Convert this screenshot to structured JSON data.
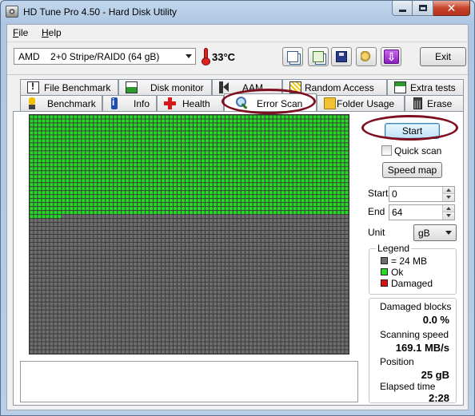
{
  "window": {
    "title": "HD Tune Pro 4.50 - Hard Disk Utility",
    "close_glyph": "✕"
  },
  "menu": [
    {
      "label": "File",
      "mnemonic": "F",
      "rest": "ile"
    },
    {
      "label": "Help",
      "mnemonic": "H",
      "rest": "elp"
    }
  ],
  "toolbar": {
    "drive_vendor": "AMD",
    "drive_name": "2+0 Stripe/RAID0 (64 gB)",
    "temperature": "33",
    "temperature_unit": "°C",
    "icons": [
      "copy-info-icon",
      "copy-screenshot-icon",
      "save-icon",
      "options-icon",
      "download-icon"
    ],
    "exit_label": "Exit"
  },
  "tabs_row1": [
    {
      "label": "File Benchmark",
      "icon": "file-benchmark-icon"
    },
    {
      "label": "Disk monitor",
      "icon": "disk-monitor-icon"
    },
    {
      "label": "AAM",
      "icon": "speaker-icon"
    },
    {
      "label": "Random Access",
      "icon": "random-access-icon"
    },
    {
      "label": "Extra tests",
      "icon": "extra-tests-icon"
    }
  ],
  "tabs_row2": [
    {
      "label": "Benchmark",
      "icon": "benchmark-icon"
    },
    {
      "label": "Info",
      "icon": "info-icon"
    },
    {
      "label": "Health",
      "icon": "health-cross-icon"
    },
    {
      "label": "Error Scan",
      "icon": "magnifier-icon",
      "active": true
    },
    {
      "label": "Folder Usage",
      "icon": "folder-icon"
    },
    {
      "label": "Erase",
      "icon": "trash-icon"
    }
  ],
  "scan_grid": {
    "columns": 80,
    "rows": 60,
    "scanned_blocks": 2008,
    "colors": {
      "ok": "#22dd22",
      "unscanned": "#6e6e6e",
      "damaged": "#dd1111",
      "gridline": "#3b3b3b"
    }
  },
  "controls": {
    "start_label": "Start",
    "quick_scan_label": "Quick scan",
    "quick_scan_checked": false,
    "speed_map_label": "Speed map",
    "start_field_label": "Start",
    "start_value": "0",
    "end_field_label": "End",
    "end_value": "64",
    "unit_label": "Unit",
    "unit_value": "gB"
  },
  "legend": {
    "title": "Legend",
    "items": [
      {
        "label": "= 24 MB",
        "color": "#6e6e6e"
      },
      {
        "label": "Ok",
        "color": "#22dd22"
      },
      {
        "label": "Damaged",
        "color": "#dd1111"
      }
    ]
  },
  "stats": {
    "damaged_blocks_label": "Damaged blocks",
    "damaged_blocks_value": "0.0 %",
    "scanning_speed_label": "Scanning speed",
    "scanning_speed_value": "169.1 MB/s",
    "position_label": "Position",
    "position_value": "25 gB",
    "elapsed_label": "Elapsed time",
    "elapsed_value": "2:28"
  },
  "log_text": ""
}
